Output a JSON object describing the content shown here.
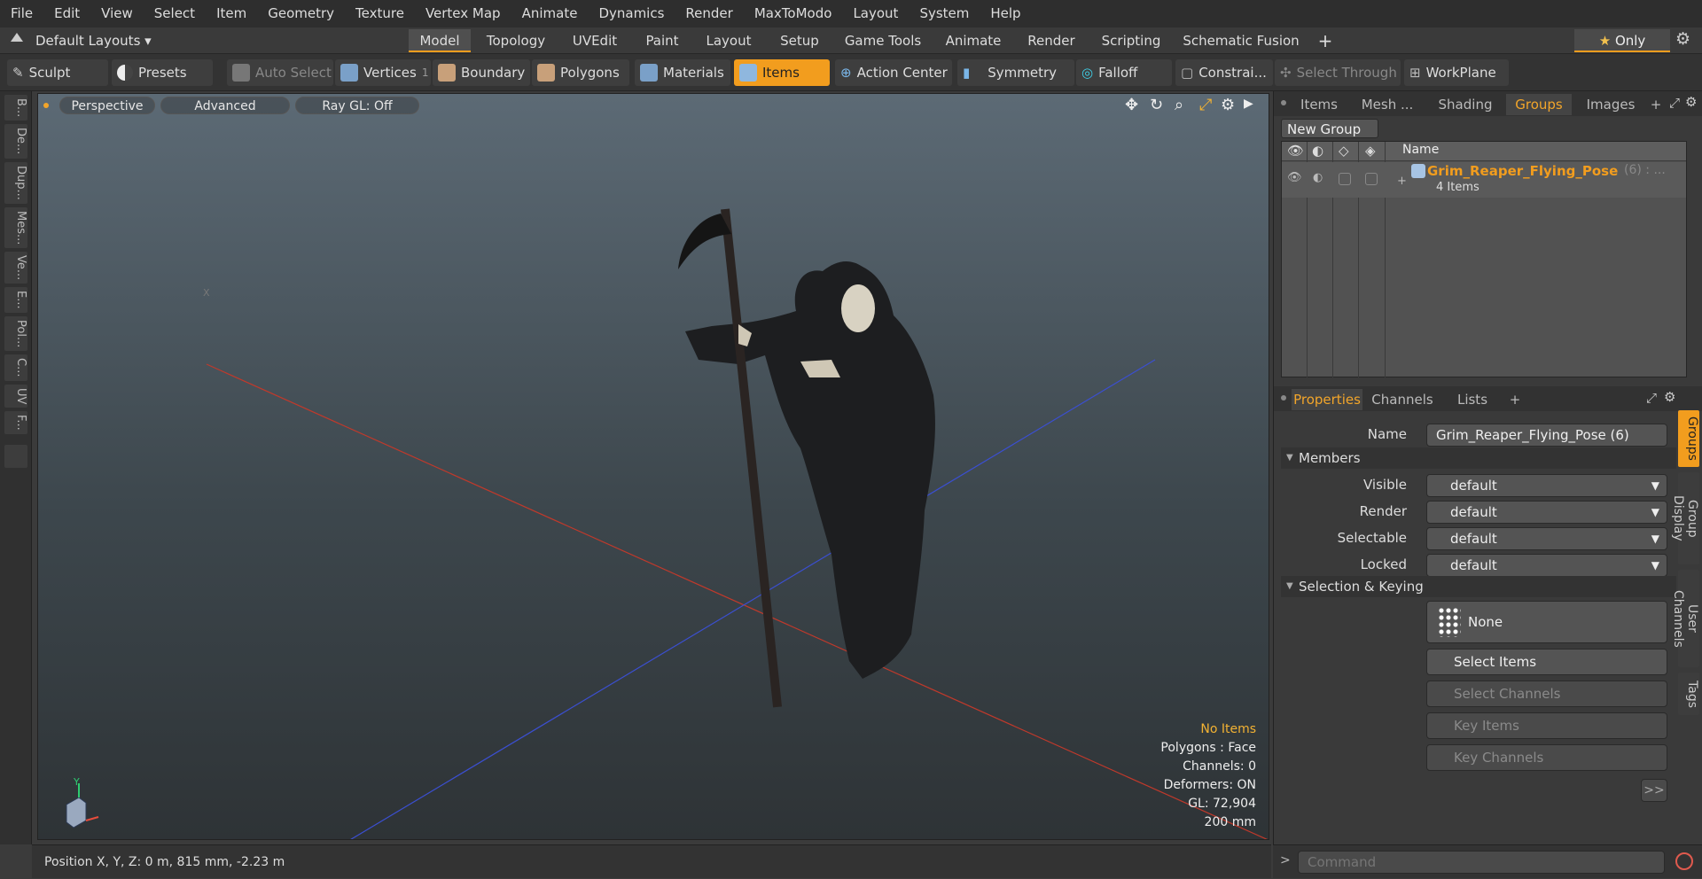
{
  "menu": [
    "File",
    "Edit",
    "View",
    "Select",
    "Item",
    "Geometry",
    "Texture",
    "Vertex Map",
    "Animate",
    "Dynamics",
    "Render",
    "MaxToModo",
    "Layout",
    "System",
    "Help"
  ],
  "layout": {
    "default_layouts": "Default Layouts",
    "tabs": [
      "Model",
      "Topology",
      "UVEdit",
      "Paint",
      "Layout",
      "Setup",
      "Game Tools",
      "Animate",
      "Render",
      "Scripting",
      "Schematic Fusion"
    ],
    "active_tab": "Model",
    "only_label": "Only",
    "plus": "+"
  },
  "toolbar": {
    "sculpt": "Sculpt",
    "presets": "Presets",
    "auto_select": "Auto Select",
    "vertices": "Vertices",
    "vertices_count": "1",
    "boundary": "Boundary",
    "polygons": "Polygons",
    "materials": "Materials",
    "items": "Items",
    "action_center": "Action Center",
    "symmetry": "Symmetry",
    "falloff": "Falloff",
    "constraints": "Constrai...",
    "select_through": "Select Through",
    "workplane": "WorkPlane"
  },
  "left_tabs": [
    "B...",
    "De...",
    "Dup...",
    "Mes...",
    "Ve...",
    "E...",
    "Pol...",
    "C...",
    "UV",
    "F..."
  ],
  "viewport": {
    "perspective": "Perspective",
    "advanced": "Advanced",
    "raygl": "Ray GL: Off",
    "info": {
      "no_items": "No Items",
      "polygons": "Polygons : Face",
      "channels": "Channels: 0",
      "deformers": "Deformers: ON",
      "gl": "GL: 72,904",
      "scale": "200 mm"
    },
    "axis_x": "X",
    "axis_y": "Y"
  },
  "status": {
    "position": "Position X, Y, Z:   0 m, 815 mm, -2.23 m",
    "command_placeholder": "Command"
  },
  "groups_panel": {
    "tabs": [
      "Items",
      "Mesh ...",
      "Shading",
      "Groups",
      "Images"
    ],
    "active_tab": "Groups",
    "new_group": "New Group",
    "col_name": "Name",
    "group_name": "Grim_Reaper_Flying_Pose",
    "group_count": "(6) : ...",
    "group_items": "4 Items"
  },
  "properties": {
    "tabs": [
      "Properties",
      "Channels",
      "Lists"
    ],
    "active_tab": "Properties",
    "name_label": "Name",
    "name_value": "Grim_Reaper_Flying_Pose (6)",
    "members": "Members",
    "visible_label": "Visible",
    "visible_value": "default",
    "render_label": "Render",
    "render_value": "default",
    "selectable_label": "Selectable",
    "selectable_value": "default",
    "locked_label": "Locked",
    "locked_value": "default",
    "selection_keying": "Selection & Keying",
    "none": "None",
    "select_items": "Select Items",
    "select_channels": "Select Channels",
    "key_items": "Key Items",
    "key_channels": "Key Channels",
    "more": ">>",
    "side_tabs": [
      "Groups",
      "Group Display",
      "User Channels",
      "Tags"
    ]
  },
  "colors": {
    "accent": "#f29d1e",
    "highlight": "#f2b233",
    "axis_red": "#c0392b",
    "axis_blue": "#3b4fd0"
  }
}
